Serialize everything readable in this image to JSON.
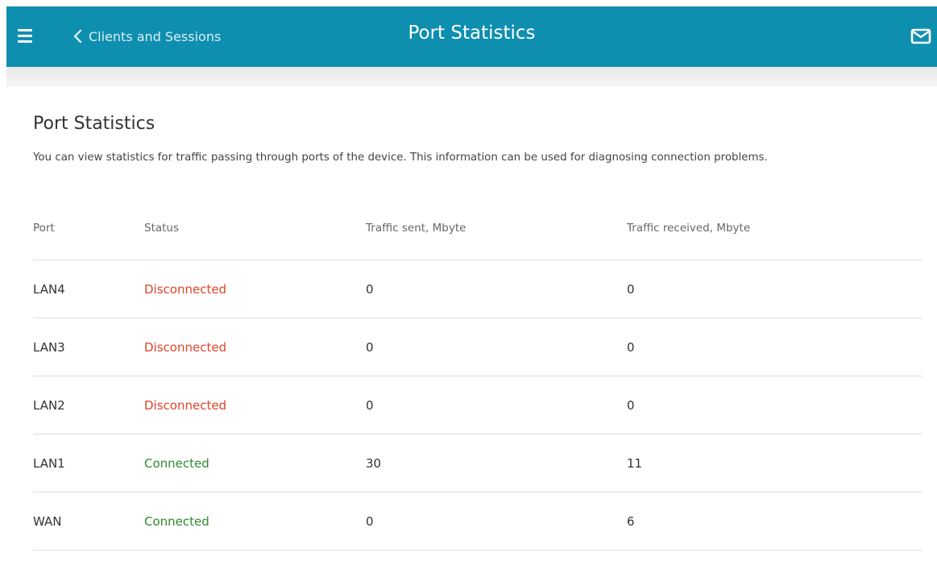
{
  "header": {
    "back_label": "Clients and Sessions",
    "title": "Port Statistics",
    "color": "#0f8fb0"
  },
  "main": {
    "title": "Port Statistics",
    "description": "You can view statistics for traffic passing through ports of the device. This information can be used for diagnosing connection problems."
  },
  "table": {
    "columns": [
      "Port",
      "Status",
      "Traffic sent, Mbyte",
      "Traffic received, Mbyte"
    ],
    "rows": [
      {
        "port": "LAN4",
        "status": "Disconnected",
        "state": "disconnected",
        "sent": "0",
        "received": "0"
      },
      {
        "port": "LAN3",
        "status": "Disconnected",
        "state": "disconnected",
        "sent": "0",
        "received": "0"
      },
      {
        "port": "LAN2",
        "status": "Disconnected",
        "state": "disconnected",
        "sent": "0",
        "received": "0"
      },
      {
        "port": "LAN1",
        "status": "Connected",
        "state": "connected",
        "sent": "30",
        "received": "11"
      },
      {
        "port": "WAN",
        "status": "Connected",
        "state": "connected",
        "sent": "0",
        "received": "6"
      }
    ]
  },
  "colors": {
    "disconnected": "#e0442a",
    "connected": "#2e8b2e"
  },
  "icons": {
    "menu": "hamburger-menu-icon",
    "back": "chevron-left-icon",
    "notifications": "envelope-icon"
  }
}
